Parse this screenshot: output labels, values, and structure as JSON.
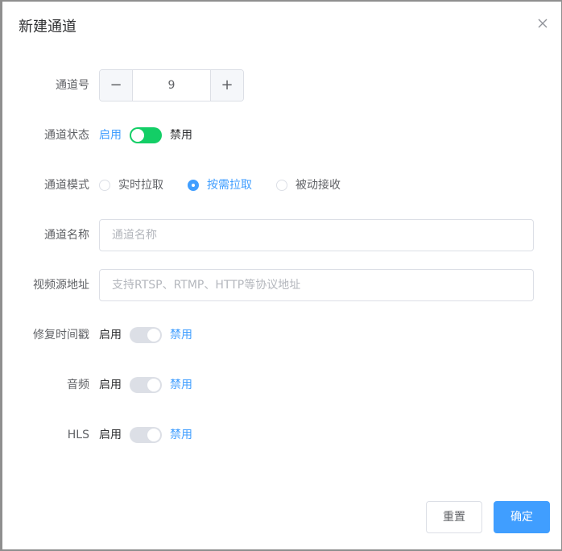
{
  "dialog": {
    "title": "新建通道"
  },
  "form": {
    "channel_number": {
      "label": "通道号",
      "value": "9",
      "minus": "−",
      "plus": "+"
    },
    "channel_status": {
      "label": "通道状态",
      "on_text": "启用",
      "off_text": "禁用",
      "state": "on"
    },
    "channel_mode": {
      "label": "通道模式",
      "options": [
        "实时拉取",
        "按需拉取",
        "被动接收"
      ],
      "selected": "按需拉取"
    },
    "channel_name": {
      "label": "通道名称",
      "placeholder": "通道名称",
      "value": ""
    },
    "video_source": {
      "label": "视频源地址",
      "placeholder": "支持RTSP、RTMP、HTTP等协议地址",
      "value": ""
    },
    "fix_timestamp": {
      "label": "修复时间戳",
      "on_text": "启用",
      "off_text": "禁用",
      "state": "off"
    },
    "audio": {
      "label": "音频",
      "on_text": "启用",
      "off_text": "禁用",
      "state": "off"
    },
    "hls": {
      "label": "HLS",
      "on_text": "启用",
      "off_text": "禁用",
      "state": "off"
    }
  },
  "footer": {
    "reset_label": "重置",
    "confirm_label": "确定"
  },
  "colors": {
    "primary": "#409eff",
    "switch_on": "#13ce66",
    "switch_off": "#dcdfe6",
    "border": "#dcdfe6"
  },
  "icons": {
    "close": "close-icon"
  }
}
